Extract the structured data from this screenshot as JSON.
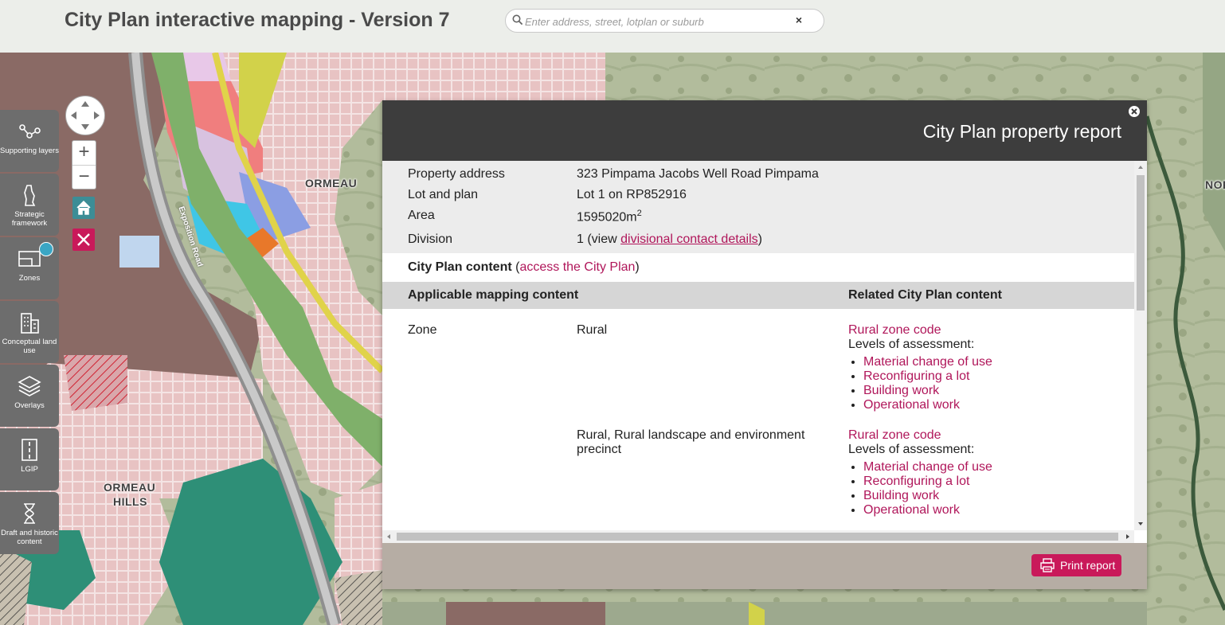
{
  "header": {
    "title": "City Plan interactive mapping - Version 7",
    "search_placeholder": "Enter address, street, lotplan or suburb",
    "clear_label": "×"
  },
  "toolbar": {
    "items": [
      {
        "label": "Supporting layers",
        "icon": "network-icon"
      },
      {
        "label": "Strategic framework",
        "icon": "region-outline-icon"
      },
      {
        "label": "Zones",
        "icon": "zones-icon"
      },
      {
        "label": "Conceptual land use",
        "icon": "buildings-icon"
      },
      {
        "label": "Overlays",
        "icon": "layers-icon"
      },
      {
        "label": "LGIP",
        "icon": "road-icon"
      },
      {
        "label": "Draft and historic content",
        "icon": "hourglass-icon"
      }
    ]
  },
  "map_controls": {
    "zoom_in": "+",
    "zoom_out": "−"
  },
  "map_labels": {
    "ormeau": "ORMEAU",
    "ormeau_hills_1": "ORMEAU",
    "ormeau_hills_2": "HILLS",
    "nor": "NOR",
    "road": "Exposition Road"
  },
  "report": {
    "title": "City Plan property report",
    "property": {
      "address_label": "Property address",
      "address_value": "323 Pimpama Jacobs Well Road Pimpama",
      "lot_label": "Lot and plan",
      "lot_value": "Lot 1 on RP852916",
      "area_label": "Area",
      "area_value": "1595020m",
      "area_unit_sup": "2",
      "division_label": "Division",
      "division_value_prefix": "1 (view ",
      "division_link": "divisional contact details",
      "division_value_suffix": ")"
    },
    "city_plan_content_label": "City Plan content",
    "city_plan_link_open": "(",
    "city_plan_link": "access the City Plan",
    "city_plan_link_close": ")",
    "table": {
      "col1": "Applicable mapping content",
      "col2": "Related City Plan content",
      "rows": [
        {
          "category": "Zone",
          "value": "Rural",
          "code_link": "Rural zone code",
          "levels_label": "Levels of assessment:",
          "links": [
            "Material change of use",
            "Reconfiguring a lot",
            "Building work",
            "Operational work"
          ]
        },
        {
          "category": "",
          "value": "Rural, Rural landscape and environment precinct",
          "code_link": "Rural zone code",
          "levels_label": "Levels of assessment:",
          "links": [
            "Material change of use",
            "Reconfiguring a lot",
            "Building work",
            "Operational work"
          ]
        }
      ]
    },
    "print_label": "Print report"
  },
  "colors": {
    "brand": "#c9195a",
    "toolbar": "#6d6d6d",
    "panel_header": "#3d3d3d",
    "teal": "#3c8d96"
  }
}
